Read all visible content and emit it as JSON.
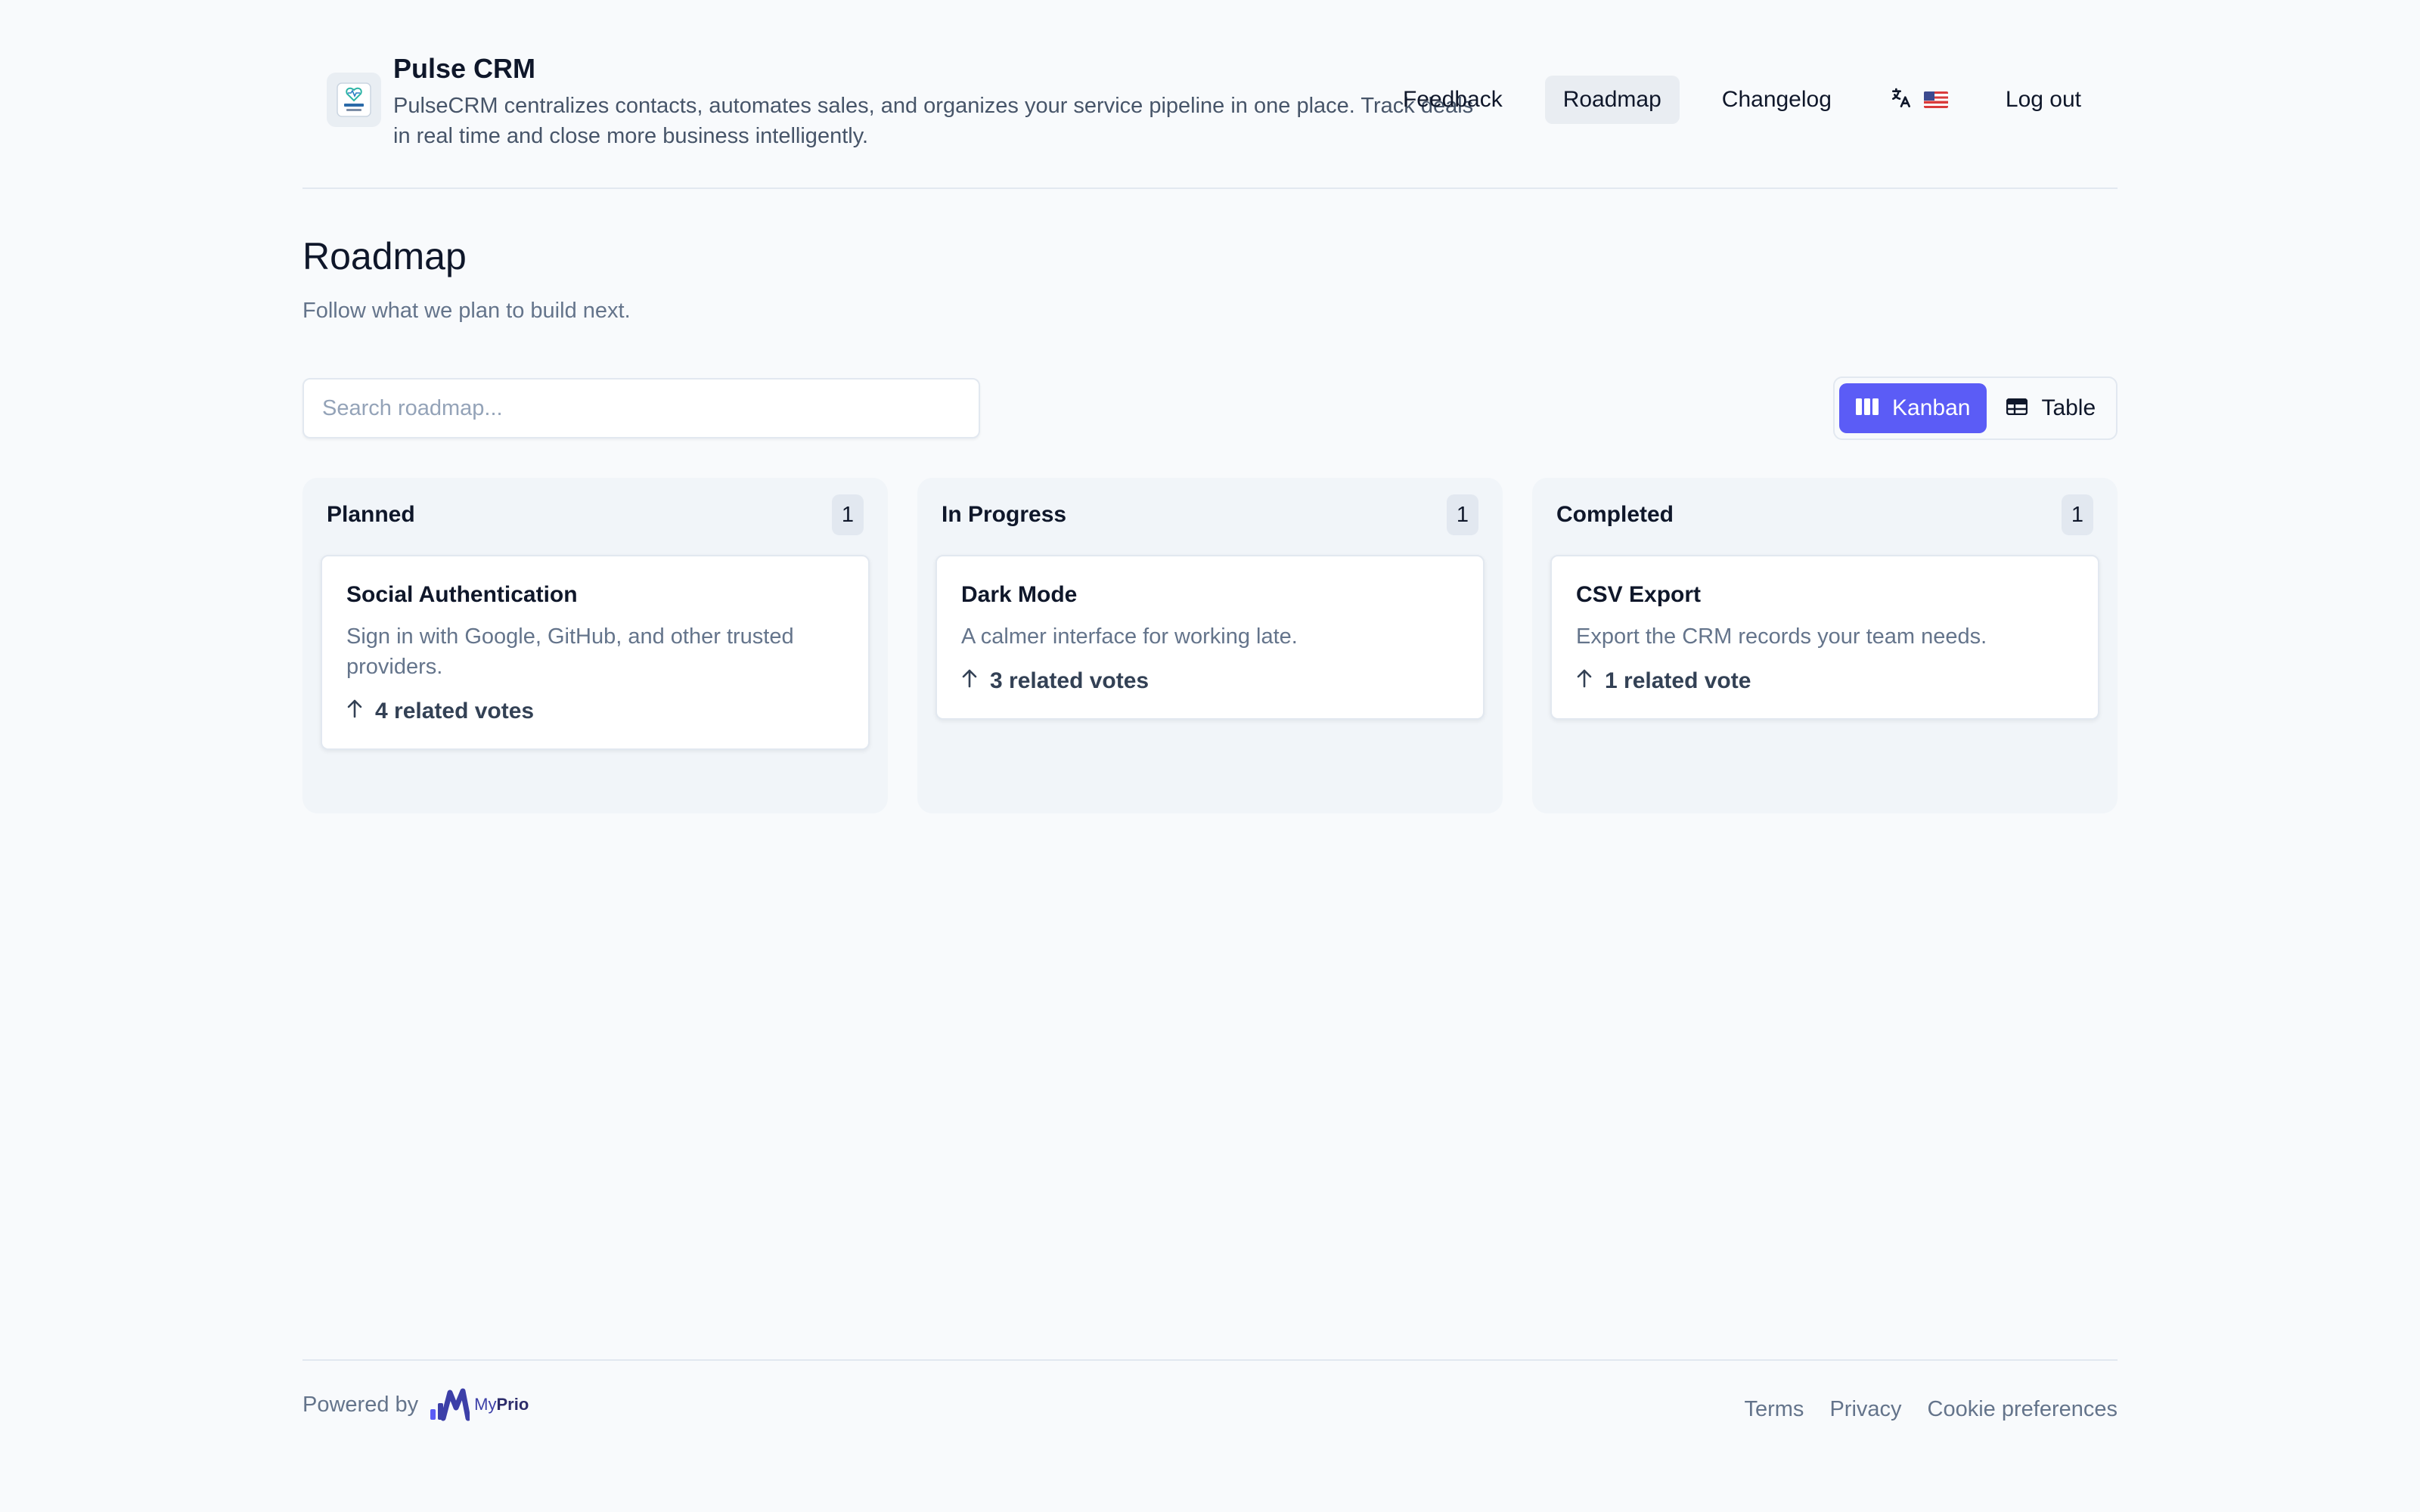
{
  "header": {
    "brand_name": "Pulse CRM",
    "brand_description": "PulseCRM centralizes contacts, automates sales, and organizes your service pipeline in one place. Track deals in real time and close more business intelligently.",
    "logo_icon": "pulse-logo-icon",
    "nav": {
      "feedback": "Feedback",
      "roadmap": "Roadmap",
      "changelog": "Changelog",
      "language_icon": "translate-icon",
      "flag_icon": "us-flag-icon",
      "logout": "Log out"
    },
    "active_nav": "Roadmap"
  },
  "page": {
    "title": "Roadmap",
    "subtitle": "Follow what we plan to build next."
  },
  "search": {
    "placeholder": "Search roadmap...",
    "value": ""
  },
  "view_toggle": {
    "kanban": "Kanban",
    "table": "Table",
    "selected": "Kanban",
    "kanban_icon": "columns-icon",
    "table_icon": "table-icon"
  },
  "columns": [
    {
      "title": "Planned",
      "count": "1",
      "cards": [
        {
          "title": "Social Authentication",
          "description": "Sign in with Google, GitHub, and other trusted providers.",
          "votes": "4 related votes"
        }
      ]
    },
    {
      "title": "In Progress",
      "count": "1",
      "cards": [
        {
          "title": "Dark Mode",
          "description": "A calmer interface for working late.",
          "votes": "3 related votes"
        }
      ]
    },
    {
      "title": "Completed",
      "count": "1",
      "cards": [
        {
          "title": "CSV Export",
          "description": "Export the CRM records your team needs.",
          "votes": "1 related vote"
        }
      ]
    }
  ],
  "footer": {
    "powered_by": "Powered by",
    "brand_my": "My",
    "brand_prio": "Prio",
    "links": {
      "terms": "Terms",
      "privacy": "Privacy",
      "cookies": "Cookie preferences"
    }
  },
  "colors": {
    "accent": "#5b5cf6",
    "background": "#f8fafc",
    "column_bg": "#f1f5f9",
    "text_primary": "#0f172a",
    "text_muted": "#64748b"
  }
}
